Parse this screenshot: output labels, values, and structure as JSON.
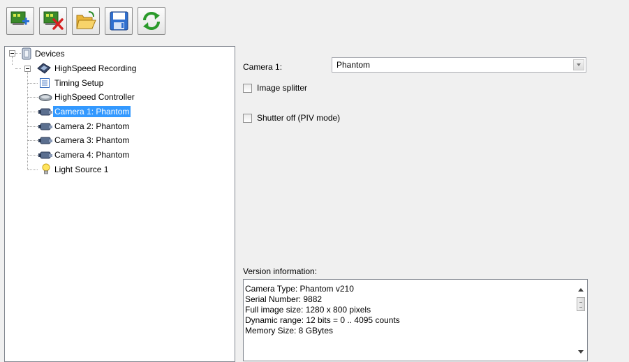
{
  "toolbar": {
    "buttons": [
      {
        "name": "add-device-button",
        "icon": "add-device-icon"
      },
      {
        "name": "remove-device-button",
        "icon": "remove-device-icon"
      },
      {
        "name": "open-button",
        "icon": "folder-open-icon"
      },
      {
        "name": "save-button",
        "icon": "save-icon"
      },
      {
        "name": "refresh-button",
        "icon": "refresh-icon"
      }
    ]
  },
  "tree": {
    "root": "Devices",
    "group": "HighSpeed Recording",
    "items": [
      {
        "label": "Timing Setup",
        "icon": "timing-icon"
      },
      {
        "label": "HighSpeed Controller",
        "icon": "controller-icon"
      },
      {
        "label": "Camera 1: Phantom",
        "icon": "camera-icon",
        "selected": true
      },
      {
        "label": "Camera 2: Phantom",
        "icon": "camera-icon"
      },
      {
        "label": "Camera 3: Phantom",
        "icon": "camera-icon"
      },
      {
        "label": "Camera 4: Phantom",
        "icon": "camera-icon"
      },
      {
        "label": "Light Source 1",
        "icon": "lightbulb-icon"
      }
    ]
  },
  "details": {
    "camera_label": "Camera 1:",
    "camera_value": "Phantom",
    "image_splitter_label": "Image splitter",
    "image_splitter_checked": false,
    "shutter_off_label": "Shutter off (PIV mode)",
    "shutter_off_checked": false,
    "version_label": "Version information:",
    "version_lines": [
      "Camera Type: Phantom v210",
      "Serial Number: 9882",
      "Full image size: 1280 x 800 pixels",
      "Dynamic range: 12 bits = 0 .. 4095 counts",
      "Memory Size: 8 GBytes"
    ]
  },
  "colors": {
    "selection": "#3399ff",
    "panel_background": "#f0f0f0"
  }
}
